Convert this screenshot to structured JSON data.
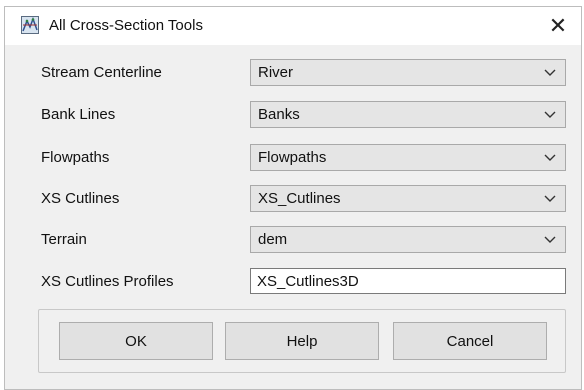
{
  "window": {
    "title": "All Cross-Section Tools",
    "close_glyph": "✕"
  },
  "fields": [
    {
      "label": "Stream Centerline",
      "value": "River"
    },
    {
      "label": "Bank Lines",
      "value": "Banks"
    },
    {
      "label": "Flowpaths",
      "value": "Flowpaths"
    },
    {
      "label": "XS Cutlines",
      "value": "XS_Cutlines"
    },
    {
      "label": "Terrain",
      "value": "dem"
    }
  ],
  "profiles": {
    "label": "XS Cutlines Profiles",
    "value": "XS_Cutlines3D"
  },
  "buttons": {
    "ok": "OK",
    "help": "Help",
    "cancel": "Cancel"
  },
  "icons": {
    "title": "hec-ras-tool-icon",
    "dropdown": "chevron-down-icon",
    "close": "close-icon"
  }
}
